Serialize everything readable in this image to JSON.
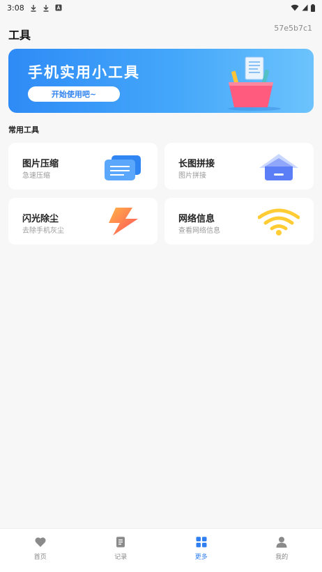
{
  "status_bar": {
    "time": "3:08"
  },
  "header": {
    "title": "工具",
    "device_code": "57e5b7c1"
  },
  "banner": {
    "title": "手机实用小工具",
    "button": "开始使用吧~"
  },
  "section": {
    "title": "常用工具"
  },
  "tools": [
    {
      "title": "图片压缩",
      "subtitle": "急速压缩",
      "icon": "image-compress-icon"
    },
    {
      "title": "长图拼接",
      "subtitle": "图片拼接",
      "icon": "stitch-icon"
    },
    {
      "title": "闪光除尘",
      "subtitle": "去除手机灰尘",
      "icon": "lightning-icon"
    },
    {
      "title": "网络信息",
      "subtitle": "查看网络信息",
      "icon": "wifi-icon"
    }
  ],
  "nav": {
    "items": [
      {
        "label": "首页",
        "icon": "heart-icon"
      },
      {
        "label": "记录",
        "icon": "document-icon"
      },
      {
        "label": "更多",
        "icon": "grid-icon",
        "active": true
      },
      {
        "label": "我的",
        "icon": "person-icon"
      }
    ]
  },
  "colors": {
    "accent": "#2f7ff0",
    "background": "#f7f7f7"
  }
}
